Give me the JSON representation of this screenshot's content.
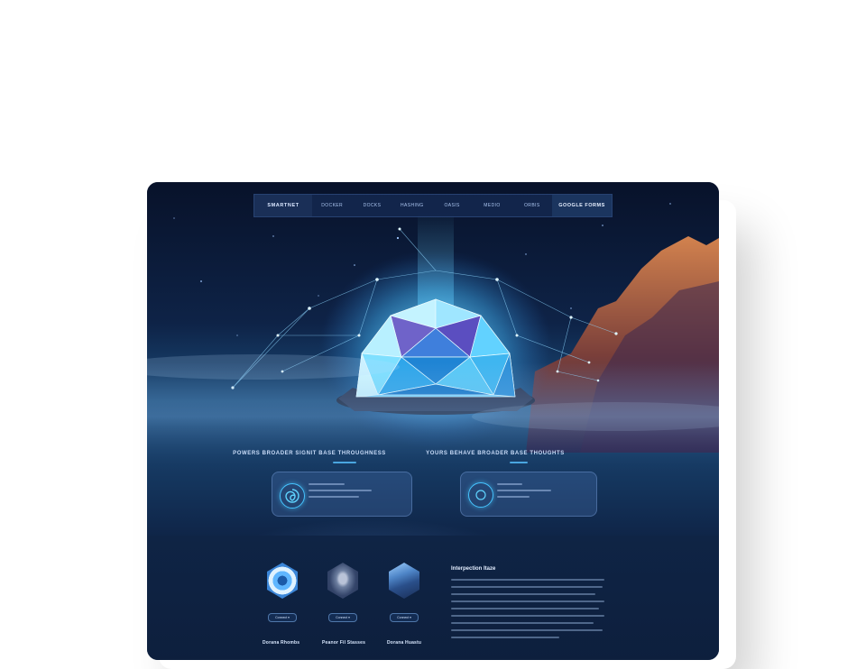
{
  "nav": {
    "brand": "SMARTNET",
    "items": [
      "DOCKER",
      "DOCKS",
      "HASHING",
      "OASIS",
      "MEDIO",
      "ORBIS"
    ],
    "cta": "GOOGLE FORMS"
  },
  "features": [
    {
      "title": "POWERS BROADER SIGNIT BASE THROUGHNESS",
      "icon": "swirl-icon"
    },
    {
      "title": "YOURS BEHAVE BROADER BASE THOUGHTS",
      "icon": "circle-icon"
    }
  ],
  "products": [
    {
      "caption": "Dorana Rhombs",
      "button": "Connect ▾",
      "icon": "blue-hex-icon"
    },
    {
      "caption": "Peanor Fil Stasses",
      "button": "Connect ▾",
      "icon": "creature-hex-icon"
    },
    {
      "caption": "Dorana Huastu",
      "button": "Connect ▾",
      "icon": "mountain-hex-icon"
    }
  ],
  "info": {
    "title": "Interpection Itaze"
  },
  "colors": {
    "accent": "#46c4ff",
    "crystal": "#6fd8ff",
    "background": "#0f2446"
  }
}
